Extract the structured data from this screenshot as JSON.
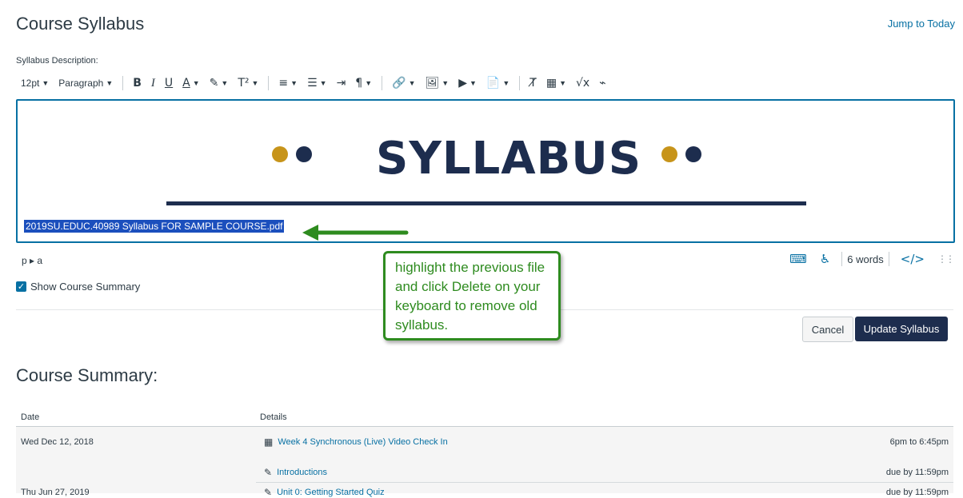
{
  "header": {
    "title": "Course Syllabus",
    "jump_link": "Jump to Today",
    "description_label": "Syllabus Description:"
  },
  "toolbar": {
    "font_size": "12pt",
    "block_format": "Paragraph",
    "bold": "B",
    "italic": "I",
    "underline": "U",
    "text_color": "A",
    "highlight": "✎",
    "superscript": "T²",
    "align": "≡",
    "list": "☰",
    "indent": "⇥",
    "direction": "¶",
    "link": "🔗",
    "image": "🖼",
    "media": "▶",
    "document": "📄",
    "clear_format": "T̸",
    "table": "▦",
    "equation": "√x",
    "embed": "⌁"
  },
  "editor": {
    "banner_title": "SYLLABUS",
    "file_link": "2019SU.EDUC.40989 Syllabus FOR SAMPLE COURSE.pdf"
  },
  "status_bar": {
    "path": "p ▸ a",
    "word_count": "6 words",
    "html_toggle": "</>"
  },
  "show_summary": {
    "label": "Show Course Summary",
    "checked": "✓"
  },
  "buttons": {
    "cancel": "Cancel",
    "update": "Update Syllabus"
  },
  "callout": {
    "text": "highlight the previous file and click Delete on your keyboard to remove old syllabus."
  },
  "course_summary": {
    "title": "Course Summary:",
    "columns": [
      "Date",
      "Details"
    ],
    "rows": [
      {
        "date": "Wed Dec 12, 2018",
        "event": "Week 4 Synchronous (Live) Video Check In",
        "icon": "calendar-icon",
        "time": "6pm to 6:45pm"
      },
      {
        "date": "",
        "event": "Introductions",
        "icon": "assignment-icon",
        "time": "due by 11:59pm"
      },
      {
        "date": "Thu Jun 27, 2019",
        "event": "Unit 0: Getting Started Quiz",
        "icon": "quiz-icon",
        "time": "due by 11:59pm"
      }
    ]
  },
  "colors": {
    "accent": "#0770a3",
    "navy": "#1d2d4e",
    "gold": "#c7941a",
    "callout_green": "#2e8b1f",
    "selection": "#1b4fbd"
  }
}
